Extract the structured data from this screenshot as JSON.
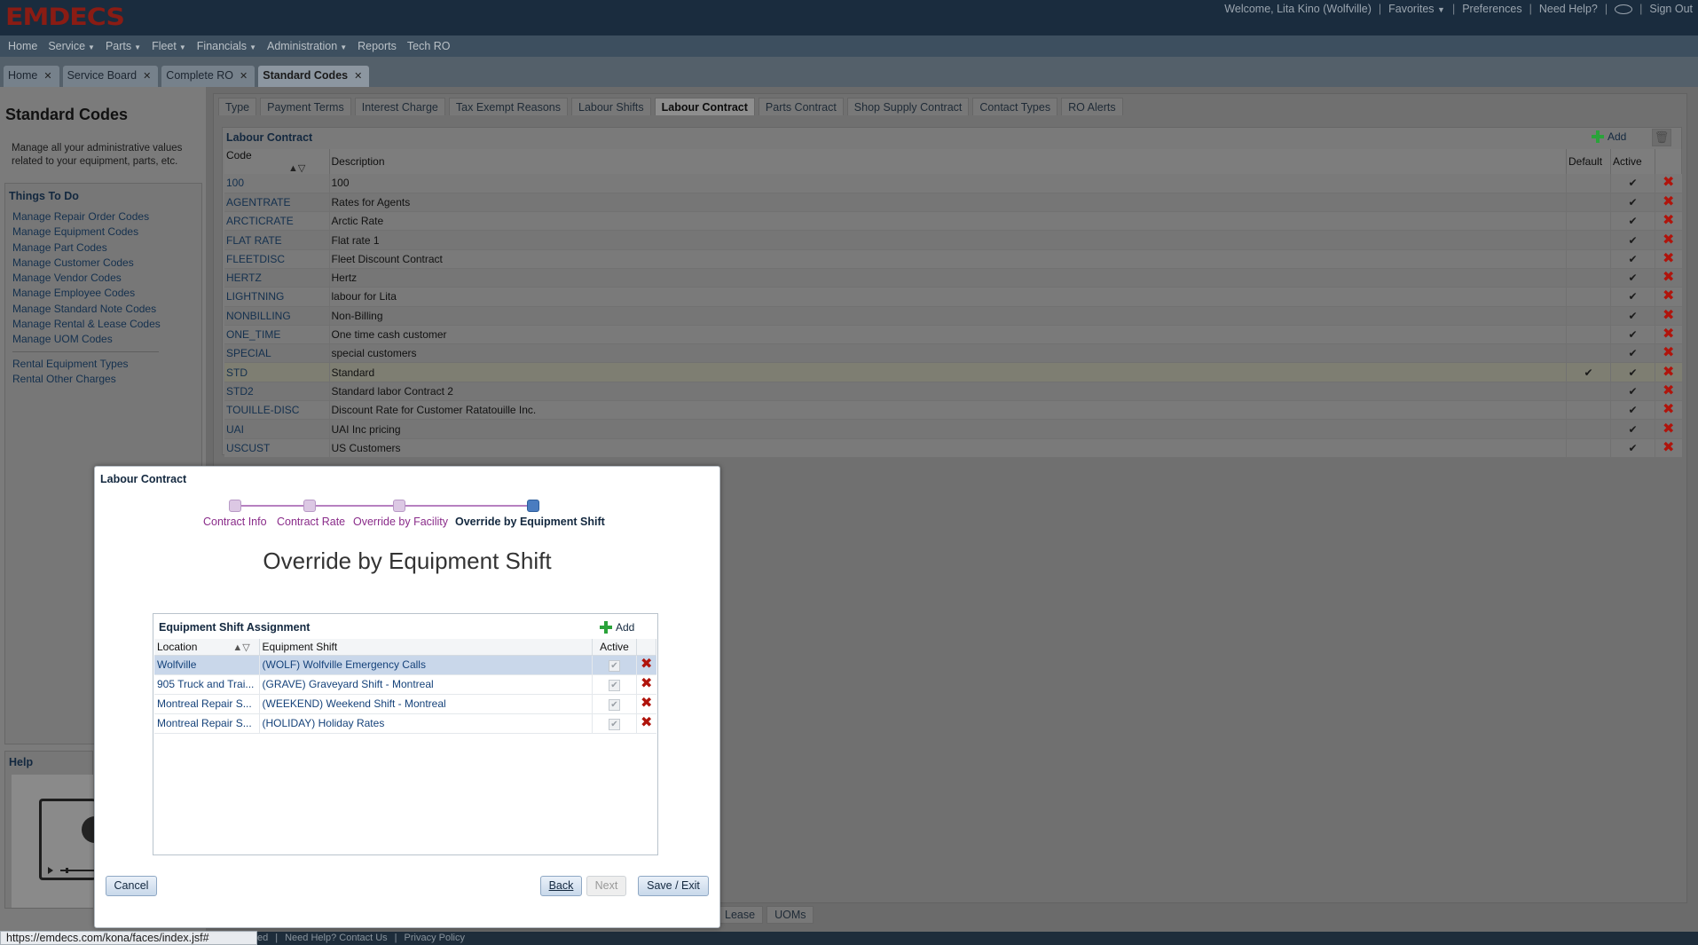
{
  "header": {
    "logo": "EMDECS",
    "welcome": "Welcome, Lita Kino (Wolfville)",
    "favorites": "Favorites",
    "preferences": "Preferences",
    "need_help": "Need Help?",
    "sign_out": "Sign Out"
  },
  "menu": {
    "home": "Home",
    "service": "Service",
    "parts": "Parts",
    "fleet": "Fleet",
    "financials": "Financials",
    "administration": "Administration",
    "reports": "Reports",
    "tech_ro": "Tech RO"
  },
  "tabs": {
    "t0": "Home",
    "t1": "Service Board",
    "t2": "Complete RO",
    "t3": "Standard Codes"
  },
  "left": {
    "title": "Standard Codes",
    "description": "Manage all your administrative values related to your equipment, parts, etc.",
    "things_to_do": "Things To Do",
    "links": {
      "l0": "Manage Repair Order Codes",
      "l1": "Manage Equipment Codes",
      "l2": "Manage Part Codes",
      "l3": "Manage Customer Codes",
      "l4": "Manage Vendor Codes",
      "l5": "Manage Employee Codes",
      "l6": "Manage Standard Note Codes",
      "l7": "Manage Rental & Lease Codes",
      "l8": "Manage UOM Codes",
      "l9": "Rental Equipment Types",
      "l10": "Rental Other Charges"
    },
    "help": "Help"
  },
  "subtabs": {
    "s0": "Type",
    "s1": "Payment Terms",
    "s2": "Interest Charge",
    "s3": "Tax Exempt Reasons",
    "s4": "Labour Shifts",
    "s5": "Labour Contract",
    "s6": "Parts Contract",
    "s7": "Shop Supply Contract",
    "s8": "Contact Types",
    "s9": "RO Alerts"
  },
  "grid": {
    "title": "Labour Contract",
    "add": "Add",
    "col_code": "Code",
    "col_desc": "Description",
    "col_default": "Default",
    "col_active": "Active",
    "check": "✔",
    "rows": {
      "r0": {
        "code": "100",
        "desc": "100"
      },
      "r1": {
        "code": "AGENTRATE",
        "desc": "Rates for Agents"
      },
      "r2": {
        "code": "ARCTICRATE",
        "desc": "Arctic Rate"
      },
      "r3": {
        "code": "FLAT RATE",
        "desc": "Flat rate 1"
      },
      "r4": {
        "code": "FLEETDISC",
        "desc": "Fleet Discount Contract"
      },
      "r5": {
        "code": "HERTZ",
        "desc": "Hertz"
      },
      "r6": {
        "code": "LIGHTNING",
        "desc": "labour for Lita"
      },
      "r7": {
        "code": "NONBILLING",
        "desc": "Non-Billing"
      },
      "r8": {
        "code": "ONE_TIME",
        "desc": "One time cash customer"
      },
      "r9": {
        "code": "SPECIAL",
        "desc": "special customers"
      },
      "r10": {
        "code": "STD",
        "desc": "Standard"
      },
      "r11": {
        "code": "STD2",
        "desc": "Standard labor Contract 2"
      },
      "r12": {
        "code": "TOUILLE-DISC",
        "desc": "Discount Rate for Customer Ratatouille Inc."
      },
      "r13": {
        "code": "UAI",
        "desc": "UAI Inc pricing"
      },
      "r14": {
        "code": "USCUST",
        "desc": "US Customers"
      }
    }
  },
  "bottom_tabs": {
    "b0": "Lease",
    "b1": "UOMs"
  },
  "footer": {
    "status_url": "https://emdecs.com/kona/faces/index.jsf#",
    "link_left": "ed",
    "help_contact": "Need Help? Contact Us",
    "privacy": "Privacy Policy"
  },
  "dialog": {
    "title": "Labour Contract",
    "heading": "Override by Equipment Shift",
    "steps": {
      "s0": "Contract Info",
      "s1": "Contract Rate",
      "s2": "Override by Facility",
      "s3": "Override by Equipment Shift"
    },
    "panel_title": "Equipment Shift Assignment",
    "add": "Add",
    "col_location": "Location",
    "col_shift": "Equipment Shift",
    "col_active": "Active",
    "rows": {
      "r0": {
        "location": "Wolfville",
        "shift": "(WOLF) Wolfville Emergency Calls"
      },
      "r1": {
        "location": "905 Truck and Trai...",
        "shift": "(GRAVE) Graveyard Shift - Montreal"
      },
      "r2": {
        "location": "Montreal Repair S...",
        "shift": "(WEEKEND) Weekend Shift - Montreal"
      },
      "r3": {
        "location": "Montreal Repair S...",
        "shift": "(HOLIDAY) Holiday Rates"
      }
    },
    "cancel": "Cancel",
    "back": "Back",
    "next": "Next",
    "save_exit": "Save / Exit"
  }
}
